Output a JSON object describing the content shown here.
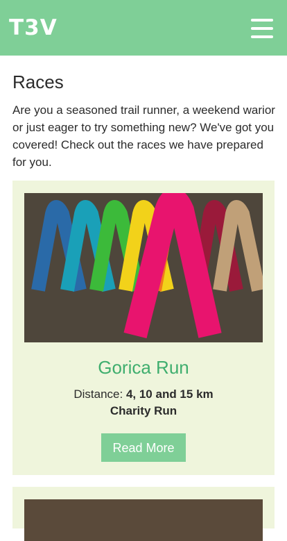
{
  "header": {
    "logo": "T3V",
    "menu_icon": "hamburger-menu-icon",
    "background": "#7fcf97"
  },
  "page": {
    "title": "Races",
    "intro": "Are you a seasoned trail runner, a weekend warior or just eager to try something new? We've got you covered! Check out the races we have prepared for you."
  },
  "races": [
    {
      "title": "Gorica Run",
      "distance_label": "Distance:",
      "distance_value": "4, 10 and 15 km",
      "type": "Charity Run",
      "button_label": "Read More"
    }
  ],
  "colors": {
    "accent": "#3fae6e",
    "card_bg": "#eff5dc",
    "button": "#7fcf97"
  }
}
